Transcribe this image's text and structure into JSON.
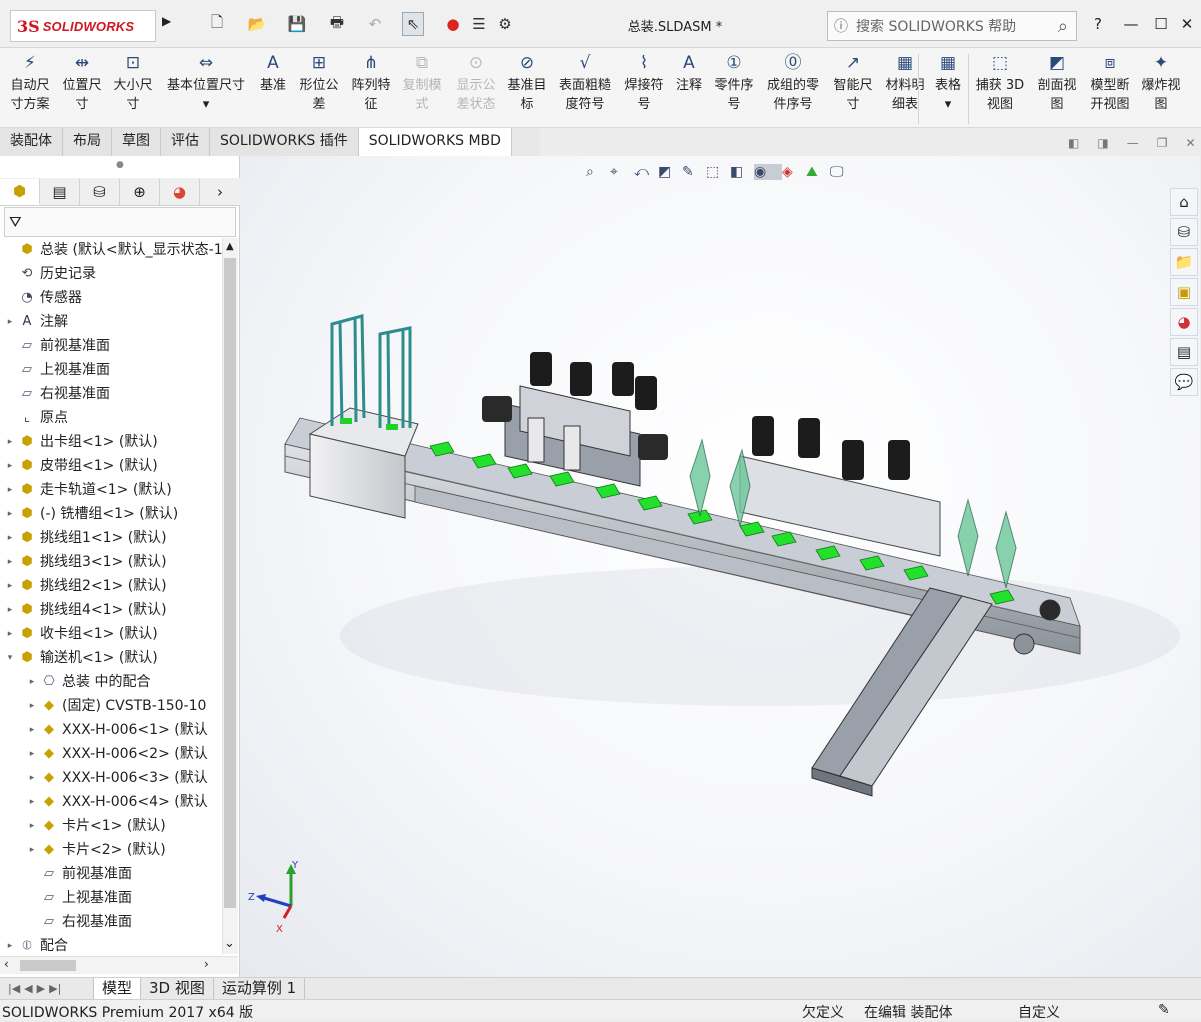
{
  "app": {
    "brand_prefix": "3S",
    "brand": "SOLIDWORKS",
    "filename": "总装.SLDASM *"
  },
  "search": {
    "placeholder": "搜索 SOLIDWORKS 帮助"
  },
  "window": {
    "help": "?",
    "minimize": "—",
    "maximize": "☐",
    "close": "✕"
  },
  "ribbon": [
    {
      "l1": "自动尺",
      "l2": "寸方案",
      "icon": "auto-dim-icon",
      "dis": false
    },
    {
      "l1": "位置尺",
      "l2": "寸",
      "icon": "location-dim-icon",
      "dis": false
    },
    {
      "l1": "大小尺",
      "l2": "寸",
      "icon": "size-dim-icon",
      "dis": false
    },
    {
      "l1": "基本位置尺寸",
      "l2": "▾",
      "icon": "basic-location-dim-icon",
      "dis": false
    },
    {
      "l1": "基准",
      "l2": "",
      "icon": "datum-icon",
      "dis": false
    },
    {
      "l1": "形位公",
      "l2": "差",
      "icon": "gtol-icon",
      "dis": false
    },
    {
      "l1": "阵列特",
      "l2": "征",
      "icon": "pattern-feature-icon",
      "dis": false
    },
    {
      "l1": "复制模",
      "l2": "式",
      "icon": "copy-scheme-icon",
      "dis": true
    },
    {
      "l1": "显示公",
      "l2": "差状态",
      "icon": "tolerance-status-icon",
      "dis": true
    },
    {
      "l1": "基准目",
      "l2": "标",
      "icon": "datum-target-icon",
      "dis": false
    },
    {
      "l1": "表面粗糙",
      "l2": "度符号",
      "icon": "surface-finish-icon",
      "dis": false
    },
    {
      "l1": "焊接符",
      "l2": "号",
      "icon": "weld-symbol-icon",
      "dis": false
    },
    {
      "l1": "注释",
      "l2": "",
      "icon": "note-icon",
      "dis": false
    },
    {
      "l1": "零件序",
      "l2": "号",
      "icon": "balloon-icon",
      "dis": false
    },
    {
      "l1": "成组的零",
      "l2": "件序号",
      "icon": "stacked-balloon-icon",
      "dis": false
    },
    {
      "l1": "智能尺",
      "l2": "寸",
      "icon": "smart-dimension-icon",
      "dis": false
    },
    {
      "l1": "材料明",
      "l2": "细表",
      "icon": "bom-icon",
      "dis": false
    },
    {
      "l1": "表格",
      "l2": "▾",
      "icon": "table-icon",
      "dis": false
    },
    {
      "l1": "捕获 3D",
      "l2": "视图",
      "icon": "capture-3d-view-icon",
      "dis": false
    },
    {
      "l1": "剖面视",
      "l2": "图",
      "icon": "section-view-icon",
      "dis": false
    },
    {
      "l1": "模型断",
      "l2": "开视图",
      "icon": "model-break-icon",
      "dis": false
    },
    {
      "l1": "爆炸视",
      "l2": "图",
      "icon": "exploded-view-icon",
      "dis": false
    }
  ],
  "tabs": [
    "装配体",
    "布局",
    "草图",
    "评估",
    "SOLIDWORKS 插件",
    "SOLIDWORKS MBD"
  ],
  "tree": [
    {
      "label": "总装  (默认<默认_显示状态-1",
      "level": 0,
      "tw": "",
      "icon": "assembly-icon"
    },
    {
      "label": "历史记录",
      "level": 1,
      "tw": "",
      "icon": "history-icon"
    },
    {
      "label": "传感器",
      "level": 1,
      "tw": "",
      "icon": "sensor-icon"
    },
    {
      "label": "注解",
      "level": 1,
      "tw": "▸",
      "icon": "annotation-icon"
    },
    {
      "label": "前视基准面",
      "level": 1,
      "tw": "",
      "icon": "plane-icon"
    },
    {
      "label": "上视基准面",
      "level": 1,
      "tw": "",
      "icon": "plane-icon"
    },
    {
      "label": "右视基准面",
      "level": 1,
      "tw": "",
      "icon": "plane-icon"
    },
    {
      "label": "原点",
      "level": 1,
      "tw": "",
      "icon": "origin-icon"
    },
    {
      "label": "出卡组<1> (默认)",
      "level": 1,
      "tw": "▸",
      "icon": "subassembly-icon"
    },
    {
      "label": "皮带组<1> (默认)",
      "level": 1,
      "tw": "▸",
      "icon": "subassembly-icon"
    },
    {
      "label": "走卡轨道<1> (默认)",
      "level": 1,
      "tw": "▸",
      "icon": "subassembly-icon"
    },
    {
      "label": "(-) 铣槽组<1> (默认)",
      "level": 1,
      "tw": "▸",
      "icon": "subassembly-icon"
    },
    {
      "label": "挑线组1<1> (默认)",
      "level": 1,
      "tw": "▸",
      "icon": "subassembly-icon"
    },
    {
      "label": "挑线组3<1> (默认)",
      "level": 1,
      "tw": "▸",
      "icon": "subassembly-icon"
    },
    {
      "label": "挑线组2<1> (默认)",
      "level": 1,
      "tw": "▸",
      "icon": "subassembly-icon"
    },
    {
      "label": "挑线组4<1> (默认)",
      "level": 1,
      "tw": "▸",
      "icon": "subassembly-icon"
    },
    {
      "label": "收卡组<1> (默认)",
      "level": 1,
      "tw": "▸",
      "icon": "subassembly-icon"
    },
    {
      "label": "输送机<1> (默认)",
      "level": 1,
      "tw": "▾",
      "icon": "subassembly-icon"
    },
    {
      "label": "总装 中的配合",
      "level": 2,
      "tw": "▸",
      "icon": "mates-folder-icon"
    },
    {
      "label": "(固定) CVSTB-150-10",
      "level": 2,
      "tw": "▸",
      "icon": "part-icon"
    },
    {
      "label": "XXX-H-006<1> (默认",
      "level": 2,
      "tw": "▸",
      "icon": "part-icon"
    },
    {
      "label": "XXX-H-006<2> (默认",
      "level": 2,
      "tw": "▸",
      "icon": "part-icon"
    },
    {
      "label": "XXX-H-006<3> (默认",
      "level": 2,
      "tw": "▸",
      "icon": "part-icon"
    },
    {
      "label": "XXX-H-006<4> (默认",
      "level": 2,
      "tw": "▸",
      "icon": "part-icon"
    },
    {
      "label": "卡片<1> (默认)",
      "level": 2,
      "tw": "▸",
      "icon": "part-icon"
    },
    {
      "label": "卡片<2> (默认)",
      "level": 2,
      "tw": "▸",
      "icon": "part-icon"
    },
    {
      "label": "前视基准面",
      "level": 2,
      "tw": "",
      "icon": "plane-icon"
    },
    {
      "label": "上视基准面",
      "level": 2,
      "tw": "",
      "icon": "plane-icon"
    },
    {
      "label": "右视基准面",
      "level": 2,
      "tw": "",
      "icon": "plane-icon"
    },
    {
      "label": "配合",
      "level": 0,
      "tw": "▸",
      "icon": "mates-icon"
    }
  ],
  "bottom_tabs": [
    "模型",
    "3D 视图",
    "运动算例 1"
  ],
  "status": {
    "product": "SOLIDWORKS Premium 2017 x64 版",
    "underdefined": "欠定义",
    "editing": "在编辑 装配体",
    "custom": "自定义"
  },
  "triad": {
    "x": "X",
    "y": "Y",
    "z": "Z"
  }
}
